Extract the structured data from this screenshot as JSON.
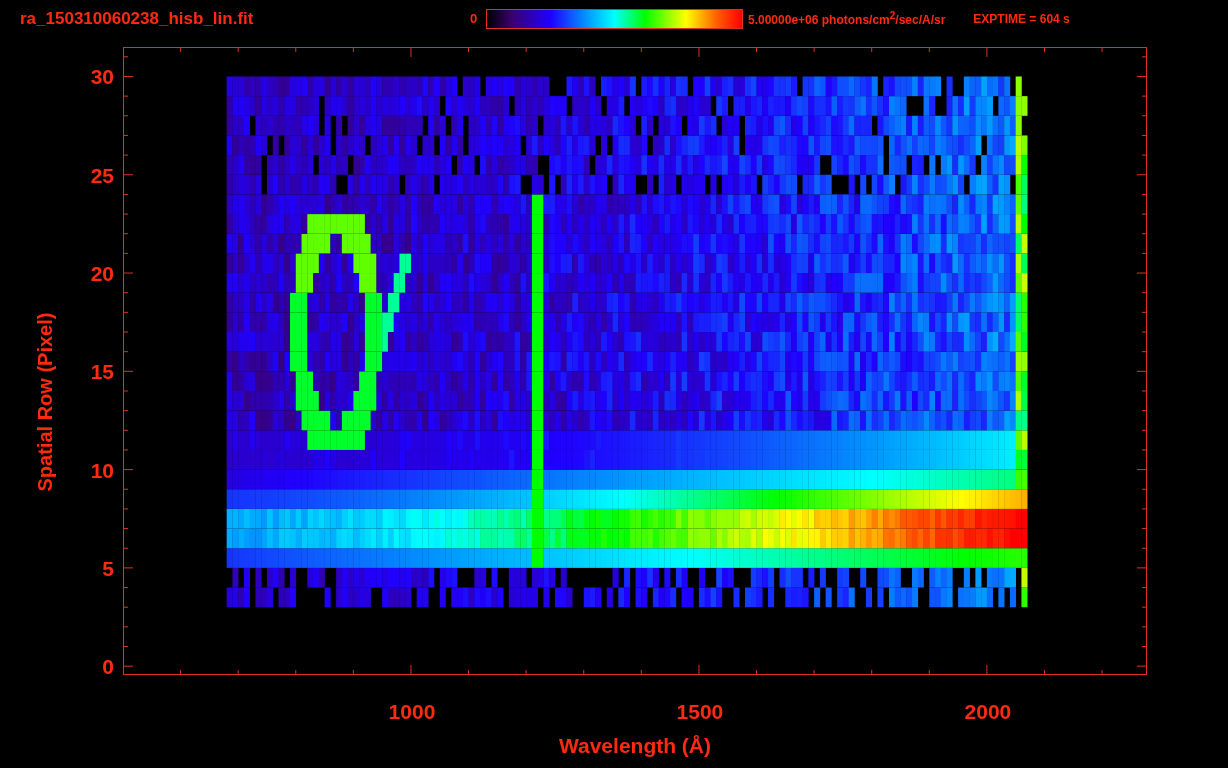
{
  "title": "ra_150310060238_hisb_lin.fit",
  "color_scale": {
    "min_label": "0",
    "max_label": "5.00000e+06 photons/cm$^{2}$/sec/A/sr"
  },
  "exposure": "EXPTIME = 604 s",
  "plot": {
    "y_axis": {
      "title": "Spatial Row (Pixel)",
      "ticks": [
        "30",
        "25",
        "20",
        "15",
        "10",
        "5",
        "0"
      ]
    },
    "x_axis": {
      "title": "Wavelength (Å)",
      "ticks": [
        "1000",
        "1500",
        "2000"
      ]
    }
  }
}
